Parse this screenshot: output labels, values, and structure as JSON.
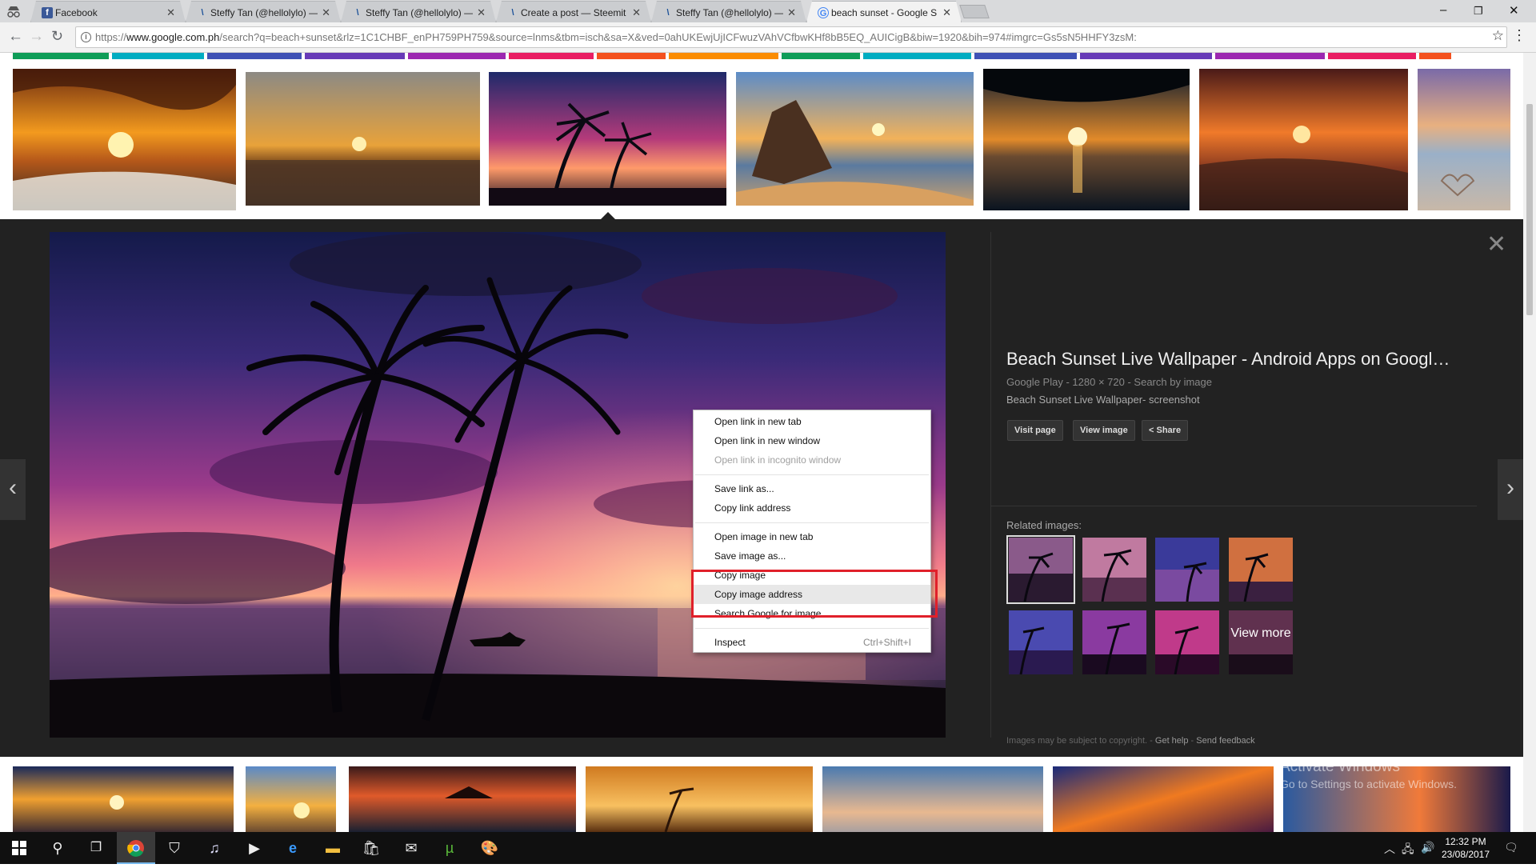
{
  "browser": {
    "tabs": [
      {
        "label": "Facebook",
        "favicon": "f",
        "color": "#3b5998"
      },
      {
        "label": "Steffy Tan (@hellolylo) —",
        "favicon": "\\",
        "color": "#1a5099"
      },
      {
        "label": "Steffy Tan (@hellolylo) —",
        "favicon": "\\",
        "color": "#1a5099"
      },
      {
        "label": "Create a post — Steemit",
        "favicon": "\\",
        "color": "#1a5099"
      },
      {
        "label": "Steffy Tan (@hellolylo) —",
        "favicon": "\\",
        "color": "#1a5099"
      },
      {
        "label": "beach sunset - Google S",
        "favicon": "G",
        "color": "#4285f4"
      }
    ],
    "address": {
      "scheme": "https://",
      "host": "www.google.com.ph",
      "path": "/search?q=beach+sunset&rlz=1C1CHBF_enPH759PH759&source=lnms&tbm=isch&sa=X&ved=0ahUKEwjUjICFwuzVAhVCfbwKHf8bB5EQ_AUICigB&biw=1920&bih=974#imgrc=Gs5sN5HHFY3zsM:"
    }
  },
  "colorbars": [
    "#0f9d58",
    "#00acc1",
    "#3f51b5",
    "#673ab7",
    "#9c27b0",
    "#e91e63",
    "#f4511e",
    "#fb8c00",
    "#0f9d58",
    "#00acc1",
    "#3f51b5",
    "#673ab7",
    "#9c27b0",
    "#e91e63",
    "#f4511e"
  ],
  "detail": {
    "title": "Beach Sunset Live Wallpaper - Android Apps on Googl…",
    "source": "Google Play",
    "dimensions": "1280 × 720",
    "search_by_image": "Search by image",
    "description": "Beach Sunset Live Wallpaper- screenshot",
    "buttons": {
      "visit": "Visit page",
      "view": "View image",
      "share": "Share"
    },
    "related_label": "Related images:",
    "view_more": "View more",
    "footer": {
      "notice": "Images may be subject to copyright.",
      "help": "Get help",
      "feedback": "Send feedback"
    }
  },
  "context_menu": {
    "items": [
      {
        "label": "Open link in new tab",
        "disabled": false
      },
      {
        "label": "Open link in new window",
        "disabled": false
      },
      {
        "label": "Open link in incognito window",
        "disabled": true
      },
      {
        "label": "Save link as...",
        "disabled": false
      },
      {
        "label": "Copy link address",
        "disabled": false
      },
      {
        "label": "Open image in new tab",
        "disabled": false
      },
      {
        "label": "Save image as...",
        "disabled": false
      },
      {
        "label": "Copy image",
        "disabled": false
      },
      {
        "label": "Copy image address",
        "disabled": false,
        "hover": true
      },
      {
        "label": "Search Google for image",
        "disabled": false
      },
      {
        "label": "Inspect",
        "disabled": false,
        "shortcut": "Ctrl+Shift+I"
      }
    ]
  },
  "watermark": {
    "line1": "Activate Windows",
    "line2": "Go to Settings to activate Windows."
  },
  "taskbar": {
    "time": "12:32 PM",
    "date": "23/08/2017"
  },
  "colors": {
    "highlight": "#e0202a",
    "panel": "#222222"
  }
}
